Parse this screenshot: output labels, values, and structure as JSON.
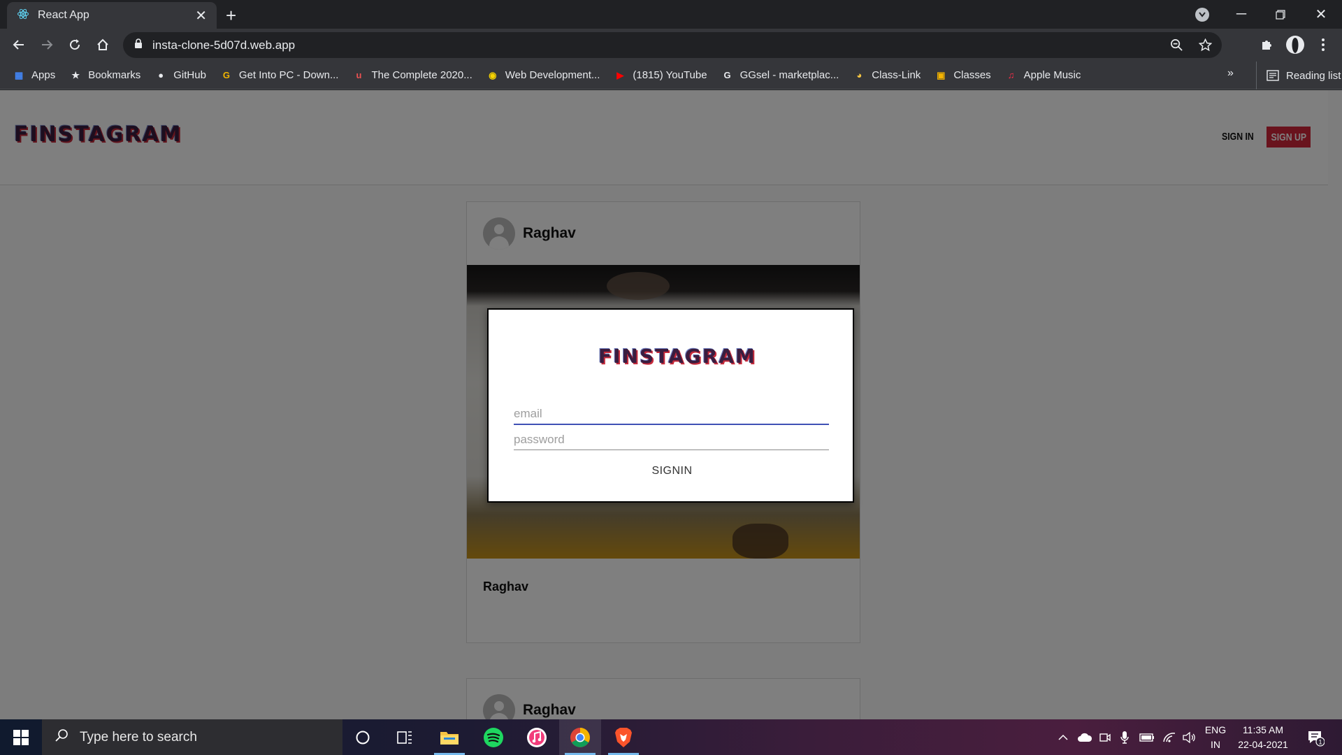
{
  "browser": {
    "tab_title": "React App",
    "url": "insta-clone-5d07d.web.app",
    "bookmarks": [
      {
        "label": "Apps",
        "icon": "apps-grid-icon",
        "color": "#4285f4"
      },
      {
        "label": "Bookmarks",
        "icon": "star-icon",
        "color": "#e8eaed"
      },
      {
        "label": "GitHub",
        "icon": "github-icon",
        "color": "#e8eaed"
      },
      {
        "label": "Get Into PC - Down...",
        "icon": "getintopc-icon",
        "color": "#f0b400"
      },
      {
        "label": "The Complete 2020...",
        "icon": "udemy-icon",
        "color": "#ec5252"
      },
      {
        "label": "Web Development...",
        "icon": "web-dev-icon",
        "color": "#f7d300"
      },
      {
        "label": "(1815) YouTube",
        "icon": "youtube-icon",
        "color": "#ff0000"
      },
      {
        "label": "GGsel - marketplac...",
        "icon": "ggsel-icon",
        "color": "#e8eaed"
      },
      {
        "label": "Class-Link",
        "icon": "class-link-icon",
        "color": "#f5c542"
      },
      {
        "label": "Classes",
        "icon": "classroom-icon",
        "color": "#f4b400"
      },
      {
        "label": "Apple Music",
        "icon": "apple-music-icon",
        "color": "#fa2d48"
      }
    ],
    "bookmarks_overflow": "»",
    "reading_list": "Reading list"
  },
  "app": {
    "logo": "FINSTAGRAM",
    "nav": {
      "signin": "SIGN IN",
      "signup": "SIGN UP"
    },
    "posts": [
      {
        "username": "Raghav",
        "caption_user": "Raghav"
      },
      {
        "username": "Raghav"
      }
    ]
  },
  "modal": {
    "logo": "FINSTAGRAM",
    "email_placeholder": "email",
    "password_placeholder": "password",
    "submit": "SIGNIN"
  },
  "taskbar": {
    "search_placeholder": "Type here to search",
    "lang": "ENG",
    "region": "IN",
    "time": "11:35 AM",
    "date": "22-04-2021",
    "notification_count": "1"
  },
  "colors": {
    "accent": "#d3263b",
    "focus": "#3f51b5"
  }
}
